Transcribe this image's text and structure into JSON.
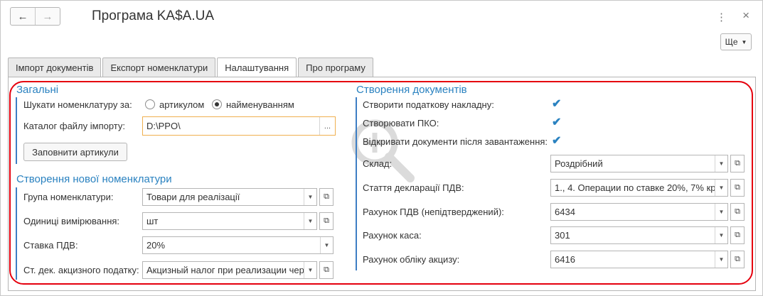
{
  "window": {
    "title": "Програма KA$A.UA",
    "more_label": "Ще",
    "back_icon": "←",
    "forward_icon": "→",
    "menu_icon": "⋮",
    "close_icon": "×"
  },
  "tabs": [
    {
      "label": "Імпорт документів"
    },
    {
      "label": "Експорт номенклатури"
    },
    {
      "label": "Налаштування"
    },
    {
      "label": "Про програму"
    }
  ],
  "general": {
    "title": "Загальні",
    "search_label": "Шукати номенклатуру за:",
    "radio_article": "артикулом",
    "radio_name": "найменуванням",
    "catalog_label": "Каталог файлу імпорту:",
    "catalog_value": "D:\\PPO\\",
    "fill_button": "Заповнити артикули"
  },
  "new_nomenclature": {
    "title": "Створення нової номенклатури",
    "group_label": "Група номенклатури:",
    "group_value": "Товари для реалізації",
    "units_label": "Одиниці вимірювання:",
    "units_value": "шт",
    "vat_label": "Ставка ПДВ:",
    "vat_value": "20%",
    "excise_label": "Ст. дек. акцизного податку:",
    "excise_value": "Акцизный налог при реализации чер"
  },
  "documents": {
    "title": "Створення документів",
    "tax_invoice_label": "Створити податкову накладну:",
    "pko_label": "Створювати ПКО:",
    "open_docs_label": "Відкривати документи після завантаження:",
    "warehouse_label": "Склад:",
    "warehouse_value": "Роздрібний",
    "vat_article_label": "Стаття декларації ПДВ:",
    "vat_article_value": "1., 4. Операции по ставке 20%, 7% кр",
    "vat_account_label": "Рахунок ПДВ (непідтверджений):",
    "vat_account_value": "6434",
    "cash_account_label": "Рахунок каса:",
    "cash_account_value": "301",
    "excise_account_label": "Рахунок обліку акцизу:",
    "excise_account_value": "6416"
  },
  "colors": {
    "accent": "#2a82c0",
    "highlight": "#e5000e",
    "focus": "#f0b050"
  }
}
